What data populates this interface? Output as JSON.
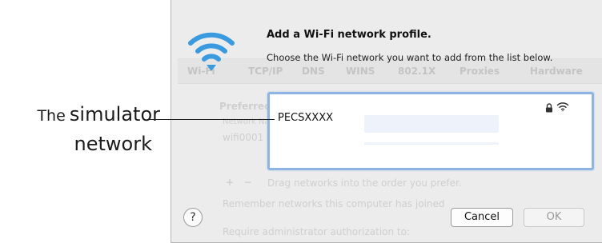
{
  "callout": {
    "prefix": "The",
    "word": "simulator",
    "line2": "network"
  },
  "dialog": {
    "title": "Add a Wi-Fi network profile.",
    "subtitle": "Choose the Wi-Fi network you want to add from the list below.",
    "network_name": "PECSXXXX",
    "cancel_label": "Cancel",
    "ok_label": "OK",
    "help_label": "?"
  },
  "background_window": {
    "tabs": [
      "Wi-Fi",
      "TCP/IP",
      "DNS",
      "WINS",
      "802.1X",
      "Proxies",
      "Hardware"
    ],
    "preferred_label": "Preferred Networks:",
    "network_label": "Network Name",
    "row_text": "wifi0001",
    "drag_hint": "Drag networks into the order you prefer.",
    "remember_text": "Remember networks this computer has joined",
    "require_text": "Require administrator authorization to:"
  },
  "colors": {
    "selection_border": "#8fb4e3",
    "wifi_blue": "#3a9ae0"
  },
  "icons": {
    "wifi": "wifi-icon",
    "lock": "lock-icon",
    "signal": "wifi-signal-icon",
    "help": "help-icon"
  }
}
